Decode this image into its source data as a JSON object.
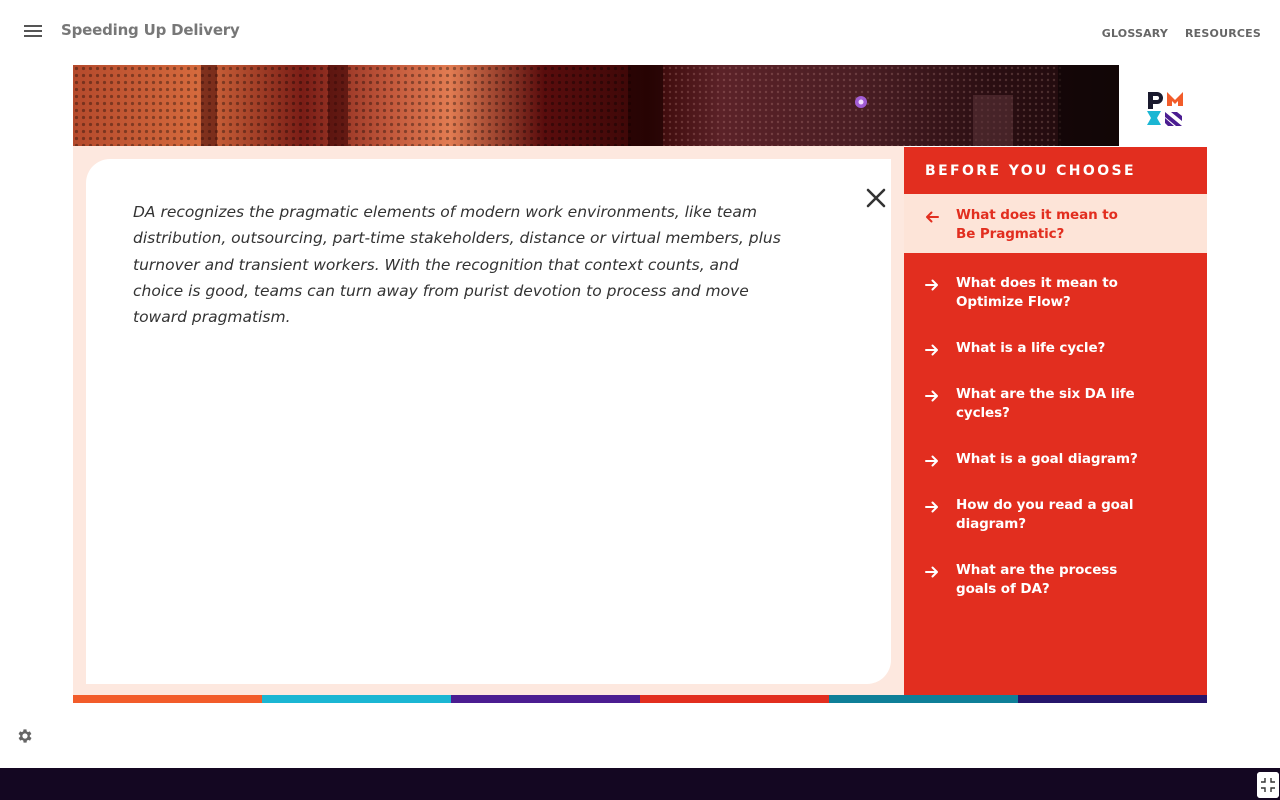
{
  "header": {
    "title": "Speeding Up Delivery",
    "links": [
      "GLOSSARY",
      "RESOURCES"
    ]
  },
  "icons": {
    "menu": "hamburger-menu-icon",
    "close": "close-x-icon",
    "arrow": "arrow-right-icon",
    "back": "arrow-left-icon",
    "settings": "gear-icon",
    "fullscreen": "exit-fullscreen-icon",
    "logo": "pmi-logo"
  },
  "content": {
    "text": "DA recognizes the pragmatic elements of modern work environments, like team distribution, outsourcing, part-time stakeholders, distance or virtual members, plus turnover and transient workers. With the recognition that context counts, and choice is good, teams can turn away from purist devotion to process and move toward pragmatism."
  },
  "sidebar": {
    "title": "BEFORE YOU CHOOSE",
    "items": [
      {
        "label": "What does it mean to\nBe Pragmatic?",
        "active": true
      },
      {
        "label": "What does it mean to\nOptimize Flow?",
        "active": false
      },
      {
        "label": "What is a life cycle?",
        "active": false
      },
      {
        "label": "What are the six DA life cycles?",
        "active": false
      },
      {
        "label": "What is a goal diagram?",
        "active": false
      },
      {
        "label": "How do you read a goal diagram?",
        "active": false
      },
      {
        "label": "What are the process\ngoals of DA?",
        "active": false
      }
    ]
  },
  "colors": {
    "accent_red": "#e22e1f",
    "panel_bg": "#fde8df",
    "active_bg": "#fde4d8",
    "footer": "#140722",
    "strip": [
      "#f25c2a",
      "#1bb6d3",
      "#4b1d91",
      "#e22e1f",
      "#0f7f98",
      "#26156b"
    ]
  }
}
